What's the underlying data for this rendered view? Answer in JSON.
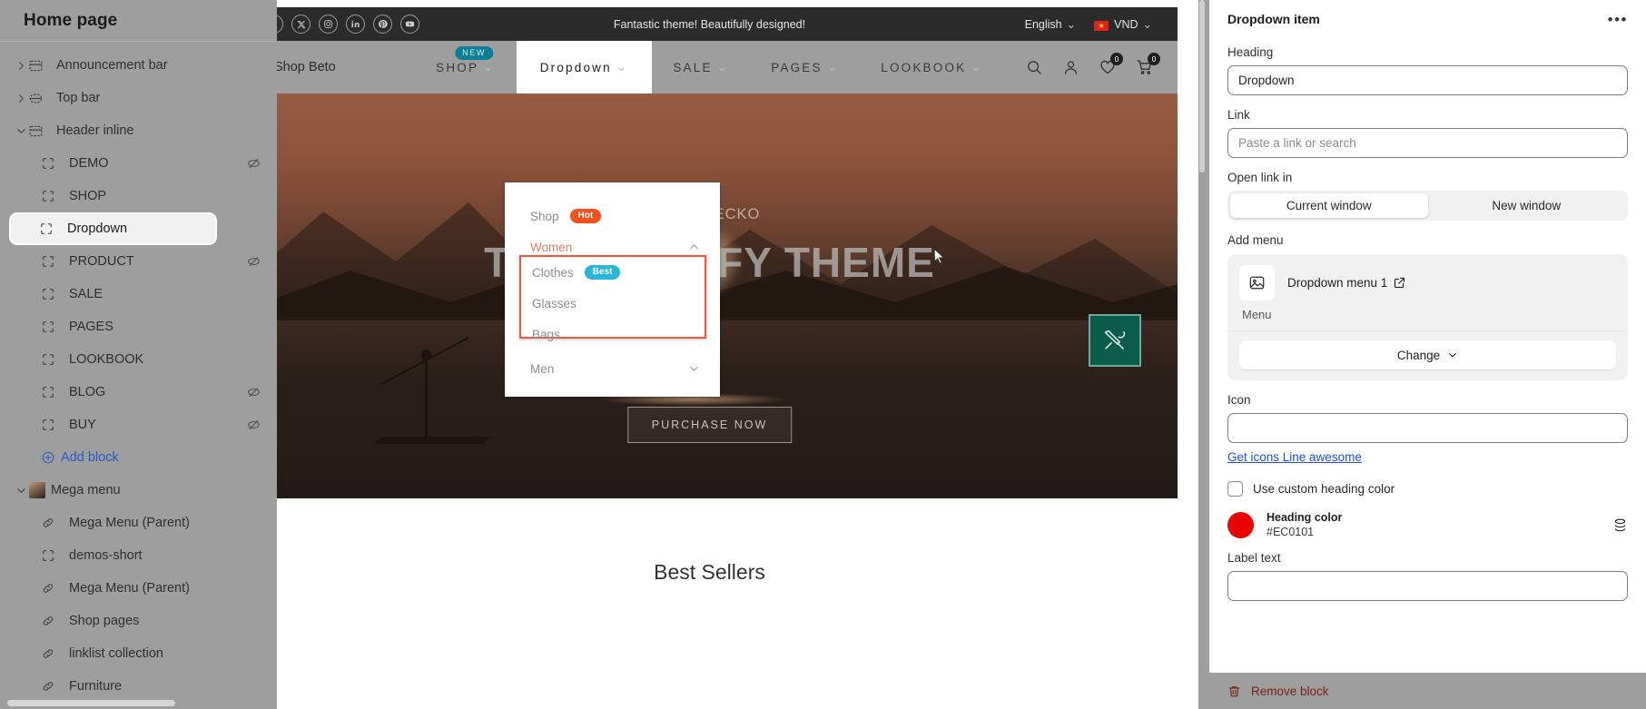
{
  "sidebar": {
    "title": "Home page",
    "items": [
      {
        "label": "Announcement bar",
        "level": 0,
        "caret": "right",
        "icon": "section-icon",
        "hidden": false
      },
      {
        "label": "Top bar",
        "level": 0,
        "caret": "right",
        "icon": "topbar-icon",
        "hidden": false
      },
      {
        "label": "Header inline",
        "level": 0,
        "caret": "down",
        "icon": "section-icon",
        "hidden": false
      },
      {
        "label": "DEMO",
        "level": 1,
        "caret": "none",
        "icon": "block-icon",
        "hidden": true
      },
      {
        "label": "SHOP",
        "level": 1,
        "caret": "none",
        "icon": "block-icon",
        "hidden": false
      },
      {
        "label": "Dropdown",
        "level": 1,
        "caret": "none",
        "icon": "block-icon",
        "hidden": false,
        "selected": true
      },
      {
        "label": "PRODUCT",
        "level": 1,
        "caret": "none",
        "icon": "block-icon",
        "hidden": true
      },
      {
        "label": "SALE",
        "level": 1,
        "caret": "none",
        "icon": "block-icon",
        "hidden": false
      },
      {
        "label": "PAGES",
        "level": 1,
        "caret": "none",
        "icon": "block-icon",
        "hidden": false
      },
      {
        "label": "LOOKBOOK",
        "level": 1,
        "caret": "none",
        "icon": "block-icon",
        "hidden": false
      },
      {
        "label": "BLOG",
        "level": 1,
        "caret": "none",
        "icon": "block-icon",
        "hidden": true
      },
      {
        "label": "BUY",
        "level": 1,
        "caret": "none",
        "icon": "block-icon",
        "hidden": true
      }
    ],
    "add_block_label": "Add block",
    "items2": [
      {
        "label": "Mega menu",
        "level": 0,
        "caret": "down",
        "icon": "thumbnail-icon",
        "hidden": false
      },
      {
        "label": "Mega Menu (Parent)",
        "level": 1,
        "caret": "none",
        "icon": "link-icon",
        "hidden": false
      },
      {
        "label": "demos-short",
        "level": 1,
        "caret": "none",
        "icon": "block-icon",
        "hidden": false
      },
      {
        "label": "Mega Menu (Parent)",
        "level": 1,
        "caret": "none",
        "icon": "link-icon",
        "hidden": false
      },
      {
        "label": "Shop pages",
        "level": 1,
        "caret": "none",
        "icon": "link-icon",
        "hidden": false
      },
      {
        "label": "linklist collection",
        "level": 1,
        "caret": "none",
        "icon": "link-icon",
        "hidden": false
      },
      {
        "label": "Furniture",
        "level": 1,
        "caret": "none",
        "icon": "link-icon",
        "hidden": false
      }
    ]
  },
  "preview": {
    "announcement": {
      "message": "Fantastic theme! Beautifully designed!",
      "socials": [
        "facebook-icon",
        "x-icon",
        "instagram-icon",
        "linkedin-icon",
        "pinterest-icon",
        "youtube-icon"
      ],
      "language": "English",
      "currency": "VND"
    },
    "header": {
      "brand": "Shop Beto",
      "nav": [
        {
          "label": "SHOP",
          "badge": "NEW",
          "active": false
        },
        {
          "label": "Dropdown",
          "badge": "",
          "active": true
        },
        {
          "label": "SALE",
          "badge": "",
          "active": false
        },
        {
          "label": "PAGES",
          "badge": "",
          "active": false
        },
        {
          "label": "LOOKBOOK",
          "badge": "",
          "active": false
        }
      ],
      "wishlist_count": "0",
      "cart_count": "0"
    },
    "dropdown": {
      "rows": [
        {
          "label": "Shop",
          "pill": "Hot",
          "pill_kind": "hot",
          "chevron": "none"
        },
        {
          "label": "Women",
          "pill": "",
          "pill_kind": "",
          "chevron": "up",
          "accent": true
        }
      ],
      "sub_rows": [
        {
          "label": "Clothes",
          "pill": "Best",
          "pill_kind": "best"
        },
        {
          "label": "Glasses",
          "pill": "",
          "pill_kind": ""
        },
        {
          "label": "Bags",
          "pill": "",
          "pill_kind": ""
        }
      ],
      "last_row": {
        "label": "Men",
        "pill": "",
        "pill_kind": "",
        "chevron": "down"
      }
    },
    "hero": {
      "subtitle": "THIS GECKO",
      "title": "THE SHOPIFY THEME",
      "button": "PURCHASE NOW"
    },
    "section_title": "Best Sellers"
  },
  "rightpanel": {
    "title": "Dropdown item",
    "more_label": "•••",
    "heading_label": "Heading",
    "heading_value": "Dropdown",
    "link_label": "Link",
    "link_placeholder": "Paste a link or search",
    "open_link_label": "Open link in",
    "open_link_options": [
      "Current window",
      "New window"
    ],
    "open_link_selected": "Current window",
    "add_menu_label": "Add menu",
    "menu_name": "Dropdown menu 1",
    "menu_sub": "Menu",
    "change_label": "Change",
    "icon_label": "Icon",
    "icon_value": "",
    "get_icons_link": "Get icons Line awesome",
    "custom_heading_color_label": "Use custom heading color",
    "custom_heading_color_checked": false,
    "heading_color_label": "Heading color",
    "heading_color_hex": "#EC0101",
    "label_text_label": "Label text",
    "label_text_value": "",
    "remove_block_label": "Remove block"
  },
  "colors": {
    "accent_red": "#EC0101",
    "pill_hot": "#F4511E",
    "pill_best": "#29B6D8",
    "badge_new": "#0A7F96",
    "link_blue": "#1E4FD1",
    "selection_outline": "#F2543D",
    "tool_green": "#0B5C4A",
    "danger": "#7A1F17"
  }
}
